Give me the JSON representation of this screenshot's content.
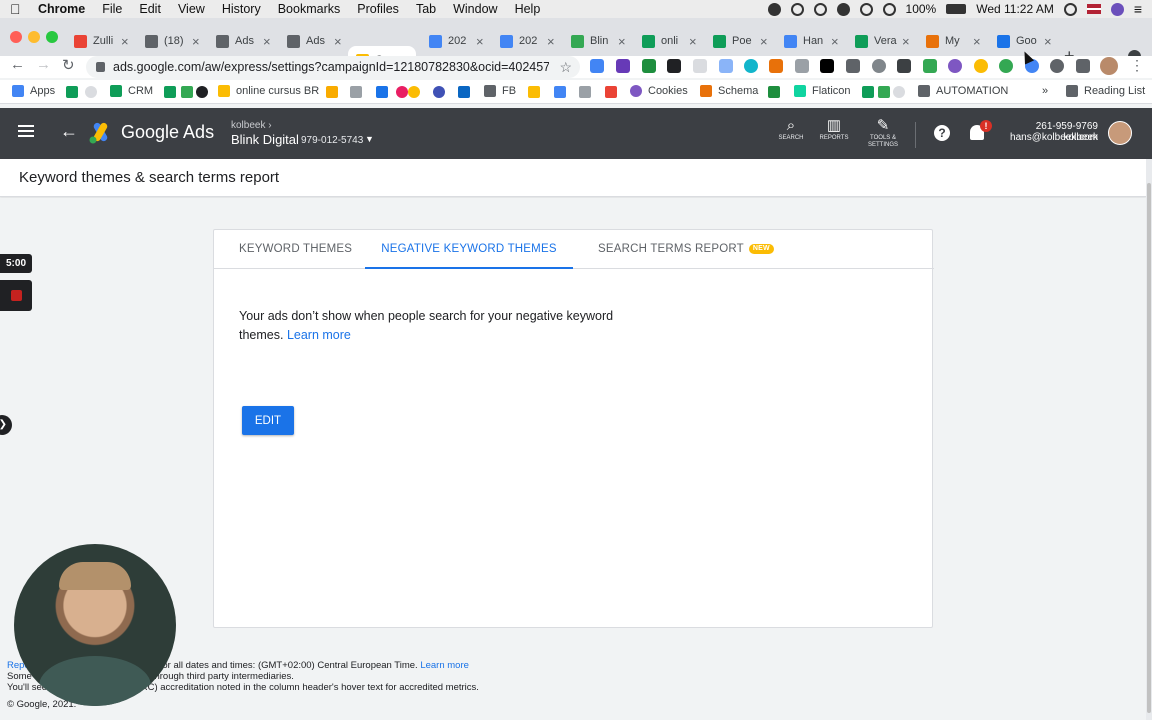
{
  "mac_menubar": {
    "app": "Chrome",
    "menus": [
      "File",
      "Edit",
      "View",
      "History",
      "Bookmarks",
      "Profiles",
      "Tab",
      "Window",
      "Help"
    ],
    "battery": "100%",
    "clock": "Wed 11:22 AM"
  },
  "tabs": [
    {
      "title": "Zulli",
      "color": "#ea4335"
    },
    {
      "title": "(18)",
      "color": "#5f6368"
    },
    {
      "title": "Ads",
      "color": "#5f6368"
    },
    {
      "title": "Ads",
      "color": "#5f6368"
    },
    {
      "title": "Cam",
      "color": "#fbbc04",
      "active": true
    },
    {
      "title": "202",
      "color": "#4285f4"
    },
    {
      "title": "202",
      "color": "#4285f4"
    },
    {
      "title": "Blin",
      "color": "#34a853"
    },
    {
      "title": "onli",
      "color": "#0f9d58"
    },
    {
      "title": "Poe",
      "color": "#0f9d58"
    },
    {
      "title": "Han",
      "color": "#4285f4"
    },
    {
      "title": "Vera",
      "color": "#0f9d58"
    },
    {
      "title": "My",
      "color": "#e8710a"
    },
    {
      "title": "Goo",
      "color": "#1a73e8"
    }
  ],
  "address_bar": {
    "url": "ads.google.com/aw/express/settings?campaignId=12180782830&ocid=402457..."
  },
  "bookmarks": {
    "apps": "Apps",
    "crm": "CRM",
    "online_cursus": "online cursus BR",
    "fb": "FB",
    "cookies": "Cookies",
    "schema": "Schema",
    "flaticon": "Flaticon",
    "automation": "AUTOMATION",
    "overflow": "»",
    "reading_list": "Reading List"
  },
  "ads_header": {
    "product": "Google Ads",
    "account_parent": "kolbeek",
    "account_name": "Blink Digital",
    "account_id": "979-012-5743",
    "tools": [
      {
        "label": "SEARCH",
        "glyph": "⌕"
      },
      {
        "label": "REPORTS",
        "glyph": "▥"
      },
      {
        "label": "TOOLS & SETTINGS",
        "glyph": "✎"
      }
    ],
    "help": "?",
    "notification_badge": "!",
    "user_phone": "261-959-9769 kolbeek",
    "user_email": "hans@kolbeek.com"
  },
  "page": {
    "title": "Keyword themes & search terms report"
  },
  "card": {
    "tabs": {
      "keyword_themes": "KEYWORD THEMES",
      "negative_keyword_themes": "NEGATIVE KEYWORD THEMES",
      "search_terms_report": "SEARCH TERMS REPORT",
      "new_badge": "NEW"
    },
    "description": "Your ads don’t show when people search for your negative keyword themes.",
    "learn_more": "Learn more",
    "edit_button": "EDIT"
  },
  "footer": {
    "line1_prefix": "Repo",
    "line1_text": "s for all dates and times: (GMT+02:00) Central European Time.",
    "line1_link": "Learn more",
    "line2_prefix": "Some",
    "line2_text": "hrough third party intermediaries.",
    "line3_prefix": "You'll see",
    "line3_text": "(MRC) accreditation noted in the column header's hover text for accredited metrics.",
    "copyright": "© Google, 2021."
  },
  "overlay": {
    "timer": "5:00"
  },
  "colors": {
    "primary_blue": "#1a73e8",
    "header_bg": "#3c3f44",
    "new_badge": "#fbbc04"
  }
}
